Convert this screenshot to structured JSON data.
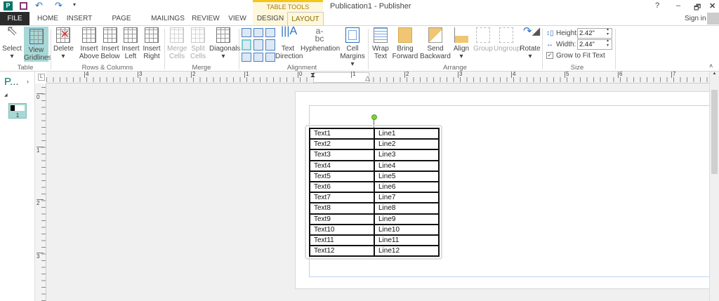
{
  "titlebar": {
    "title": "Publication1 - Publisher",
    "table_tools": "TABLE TOOLS",
    "sign_in": "Sign in",
    "help": "?",
    "minimize": "–",
    "restore": "🗗",
    "close": "✕"
  },
  "tabs": [
    "FILE",
    "HOME",
    "INSERT",
    "PAGE DESIGN",
    "MAILINGS",
    "REVIEW",
    "VIEW",
    "DESIGN",
    "LAYOUT"
  ],
  "ribbon": {
    "table": {
      "label": "Table",
      "select": "Select",
      "view_gridlines": "View Gridlines"
    },
    "rows_columns": {
      "label": "Rows & Columns",
      "delete": "Delete",
      "insert_above": "Insert Above",
      "insert_below": "Insert Below",
      "insert_left": "Insert Left",
      "insert_right": "Insert Right"
    },
    "merge": {
      "label": "Merge",
      "merge_cells": "Merge Cells",
      "split_cells": "Split Cells",
      "diagonals": "Diagonals"
    },
    "alignment": {
      "label": "Alignment",
      "text_direction": "Text Direction",
      "hyphenation": "Hyphenation",
      "cell_margins": "Cell Margins"
    },
    "arrange": {
      "label": "Arrange",
      "wrap_text": "Wrap Text",
      "bring_forward": "Bring Forward",
      "send_backward": "Send Backward",
      "align": "Align",
      "group": "Group",
      "ungroup": "Ungroup",
      "rotate": "Rotate"
    },
    "size": {
      "label": "Size",
      "height_label": "Height:",
      "height": "2.42\"",
      "width_label": "Width:",
      "width": "2.44\"",
      "grow_to_fit": "Grow to Fit Text"
    }
  },
  "pages_pane": {
    "title": "P...",
    "page_number": "1"
  },
  "ruler": {
    "h": [
      "4",
      "3",
      "2",
      "1",
      "0",
      "1",
      "2",
      "3",
      "4",
      "5",
      "6",
      "7"
    ],
    "v": [
      "0",
      "1",
      "2",
      "3"
    ]
  },
  "table": {
    "rows": [
      [
        "Text1",
        "Line1"
      ],
      [
        "Text2",
        "Line2"
      ],
      [
        "Text3",
        "Line3"
      ],
      [
        "Text4",
        "Line4"
      ],
      [
        "Text5",
        "Line5"
      ],
      [
        "Text6",
        "Line6"
      ],
      [
        "Text7",
        "Line7"
      ],
      [
        "Text8",
        "Line8"
      ],
      [
        "Text9",
        "Line9"
      ],
      [
        "Text10",
        "Line10"
      ],
      [
        "Text11",
        "Line11"
      ],
      [
        "Text12",
        "Line12"
      ]
    ]
  }
}
